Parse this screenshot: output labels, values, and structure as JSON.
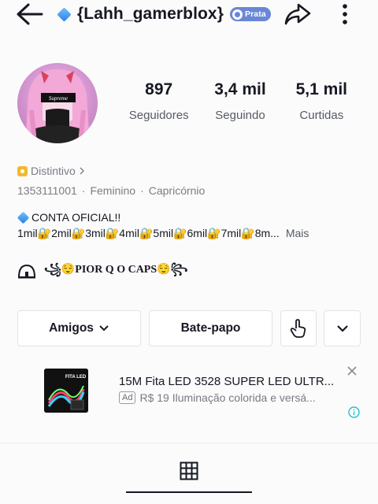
{
  "header": {
    "username": "{Lahh_gamerblox}",
    "badge_label": "Prata"
  },
  "avatar": {
    "caption": "Supreme"
  },
  "stats": [
    {
      "value": "897",
      "label": "Seguidores"
    },
    {
      "value": "3,4 mil",
      "label": "Seguindo"
    },
    {
      "value": "5,1 mil",
      "label": "Curtidas"
    }
  ],
  "profile": {
    "badge_link": "Distintivo",
    "id": "1353111001",
    "gender": "Feminino",
    "sign": "Capricórnio",
    "sep": "·"
  },
  "bio": {
    "line1": "CONTA OFICIAL!!",
    "line2": "1mil🔐2mil🔐3mil🔐4mil🔐5mil🔐6mil🔐7mil🔐8m...",
    "more": "Mais",
    "line3": "꧁😌PIOR Q O CAPS😌꧂"
  },
  "actions": {
    "friends": "Amigos",
    "chat": "Bate-papo"
  },
  "ad": {
    "title": "15M Fita LED 3528 SUPER LED ULTR...",
    "tag": "Ad",
    "subtitle": "R$ 19 Iluminação colorida e versá...",
    "thumb_title": "FITA LED"
  },
  "colors": {
    "badge_bg": "#6b86d6",
    "info_icon": "#20c0d8",
    "text_primary": "#161823",
    "text_secondary": "#7a7d85"
  }
}
